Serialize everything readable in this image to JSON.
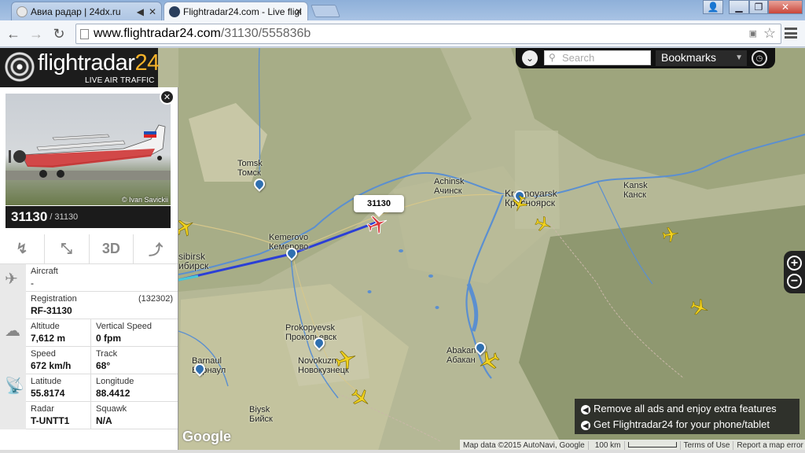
{
  "browser": {
    "tabs": [
      {
        "label": "Авиа радар | 24dx.ru",
        "active": false
      },
      {
        "label": "Flightradar24.com - Live fligh",
        "active": true
      }
    ],
    "url_host": "www.flightradar24.com",
    "url_path": "/31130/555836b"
  },
  "fr24": {
    "brand_main": "flightradar",
    "brand_num": "24",
    "tagline": "LIVE AIR TRAFFIC",
    "search_placeholder": "Search",
    "bookmarks_label": "Bookmarks"
  },
  "flight": {
    "callsign": "31130",
    "flight_number": "31130",
    "photo_credit": "© Ivan Savickii",
    "buttons": [
      "3D"
    ],
    "aircraft_label": "Aircraft",
    "aircraft_value": "-",
    "registration_label": "Registration",
    "registration_code": "(132302)",
    "registration_value": "RF-31130",
    "altitude_label": "Altitude",
    "altitude_value": "7,612 m",
    "vspeed_label": "Vertical Speed",
    "vspeed_value": "0 fpm",
    "speed_label": "Speed",
    "speed_value": "672 km/h",
    "track_label": "Track",
    "track_value": "68°",
    "lat_label": "Latitude",
    "lat_value": "55.8174",
    "lon_label": "Longitude",
    "lon_value": "88.4412",
    "radar_label": "Radar",
    "radar_value": "T-UNTT1",
    "squawk_label": "Squawk",
    "squawk_value": "N/A"
  },
  "map": {
    "callout": "31130",
    "cities": [
      {
        "en": "Tomsk",
        "ru": "Томск"
      },
      {
        "en": "Achinsk",
        "ru": "Ачинск"
      },
      {
        "en": "Krasnoyarsk",
        "ru": "Красноярск"
      },
      {
        "en": "Kansk",
        "ru": "Канск"
      },
      {
        "en": "Kemerovo",
        "ru": "Кемерово"
      },
      {
        "en": "sibirsk",
        "ru": "ибирск"
      },
      {
        "en": "Prokopyevsk",
        "ru": "Прокопьевск"
      },
      {
        "en": "Novokuzn",
        "ru": "Новокузнецк"
      },
      {
        "en": "Abakan",
        "ru": "Абакан"
      },
      {
        "en": "Barnaul",
        "ru": "Барнаул"
      },
      {
        "en": "Biysk",
        "ru": "Бийск"
      }
    ],
    "google_logo": "Google",
    "attribution": [
      "Map data ©2015 AutoNavi, Google",
      "100 km",
      "Terms of Use",
      "Report a map error"
    ]
  },
  "promo": {
    "line1": "Remove all ads and enjoy extra features",
    "line2": "Get Flightradar24 for your phone/tablet"
  },
  "colors": {
    "flight_path": "#2b3fd6",
    "plane": "#f2d21f",
    "selected_plane": "#d8343a",
    "panel_dark": "#1b1b1b",
    "brand_accent": "#f5b22a"
  }
}
